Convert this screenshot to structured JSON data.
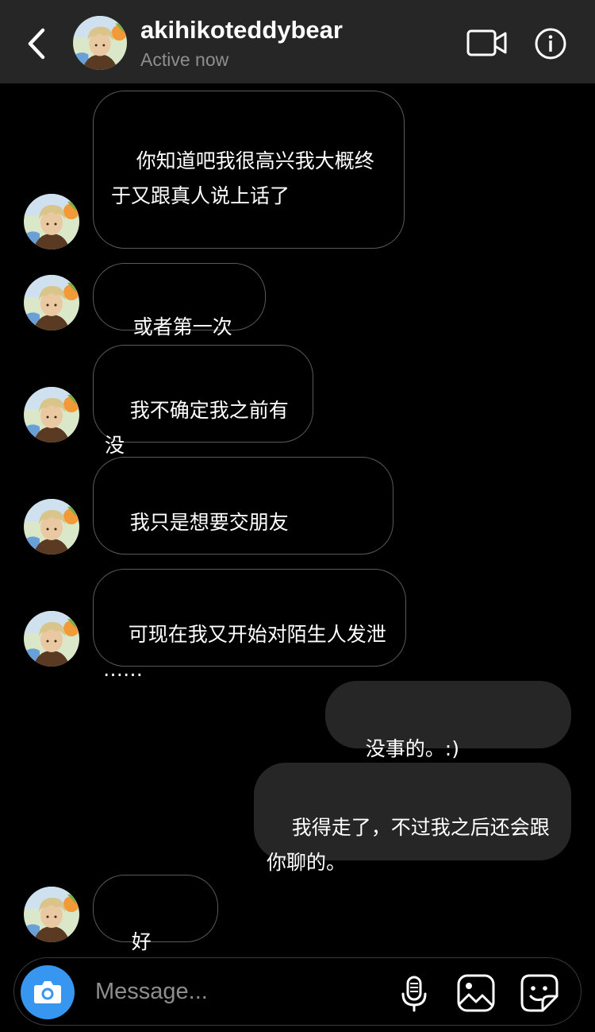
{
  "header": {
    "username": "akihikoteddybear",
    "status": "Active now"
  },
  "icons": {
    "back": "chevron-left-icon",
    "video": "video-camera-icon",
    "info": "info-icon",
    "camera": "camera-icon",
    "mic": "microphone-icon",
    "gallery": "image-icon",
    "sticker": "sticker-icon"
  },
  "colors": {
    "background": "#000000",
    "header_bg": "#262626",
    "outgoing_bubble": "#262626",
    "incoming_border": "#5a5a5a",
    "accent": "#3797f0",
    "secondary_text": "#8e8e8e"
  },
  "messages": [
    {
      "sender": "them",
      "text": "你知道吧我很高兴我大概终\n于又跟真人说上话了"
    },
    {
      "sender": "them",
      "text": "或者第一次"
    },
    {
      "sender": "them",
      "text": "我不确定我之前有没\n有"
    },
    {
      "sender": "them",
      "text": "我只是想要交朋友"
    },
    {
      "sender": "them",
      "text": "可现在我又开始对陌生人发泄\n……"
    },
    {
      "sender": "me",
      "text": "没事的。:)"
    },
    {
      "sender": "me",
      "text": "我得走了，不过我之后还会跟\n你聊的。"
    },
    {
      "sender": "them",
      "text": "好的！:]"
    }
  ],
  "composer": {
    "placeholder": "Message..."
  }
}
